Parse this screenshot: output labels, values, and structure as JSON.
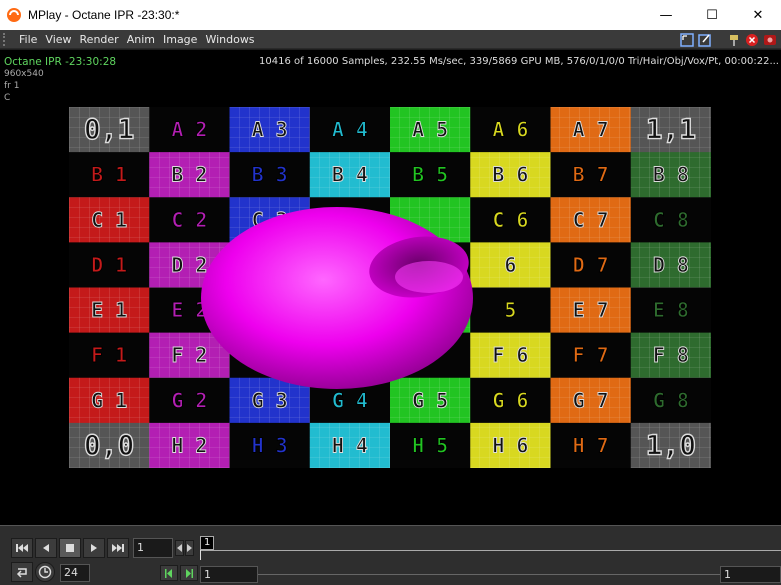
{
  "window": {
    "title": "MPlay - Octane IPR -23:30:*",
    "minimize": "—",
    "maximize": "☐",
    "close": "✕"
  },
  "menu": [
    "File",
    "View",
    "Render",
    "Anim",
    "Image",
    "Windows"
  ],
  "overlay": {
    "renderer": "Octane IPR -23:30:28",
    "resolution": "960x540",
    "frame": "fr 1",
    "channel": "C",
    "stats": "10416 of 16000 Samples, 232.55 Ms/sec, 339/5869 GPU MB, 576/0/1/0/0 Tri/Hair/Obj/Vox/Pt, 00:00:22..."
  },
  "uv_grid": {
    "rows": [
      [
        "0,1",
        "A 2",
        "A 3",
        "A 4",
        "A 5",
        "A 6",
        "A 7",
        "1,1"
      ],
      [
        "B 1",
        "B 2",
        "B 3",
        "B 4",
        "B 5",
        "B 6",
        "B 7",
        "B 8"
      ],
      [
        "C 1",
        "C 2",
        "C 3",
        "",
        "",
        "C 6",
        "C 7",
        "C 8"
      ],
      [
        "D 1",
        "D 2",
        "",
        "",
        "",
        "6",
        "D 7",
        "D 8"
      ],
      [
        "E 1",
        "E 2",
        "E",
        "",
        "",
        "5",
        "E 7",
        "E 8"
      ],
      [
        "F 1",
        "F 2",
        "F",
        "",
        "",
        "F 6",
        "F 7",
        "F 8"
      ],
      [
        "G 1",
        "G 2",
        "G 3",
        "G 4",
        "G 5",
        "G 6",
        "G 7",
        "G 8"
      ],
      [
        "0,0",
        "H 2",
        "H 3",
        "H 4",
        "H 5",
        "H 6",
        "H 7",
        "1,0"
      ]
    ],
    "column_colors": [
      "#c41a1a",
      "#b31fb3",
      "#2233cc",
      "#22bcd0",
      "#22c422",
      "#d8d820",
      "#e06a14",
      "#2e6b2e"
    ],
    "torus_color": "#ff00ff"
  },
  "playbar": {
    "current_frame": "1",
    "frame_marker": "1",
    "fps": "24",
    "range_start": "1",
    "range_end": "1"
  }
}
